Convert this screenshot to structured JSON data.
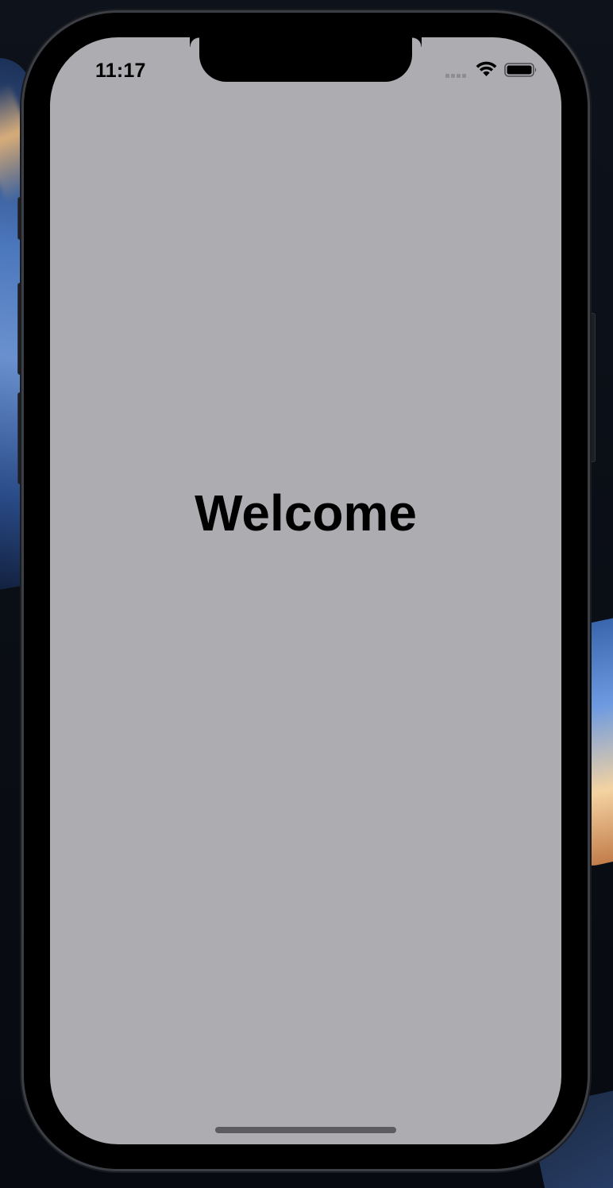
{
  "status_bar": {
    "time": "11:17",
    "icons": [
      "cellular-signal-icon",
      "wifi-icon",
      "battery-icon"
    ]
  },
  "main": {
    "heading": "Welcome"
  },
  "colors": {
    "screen_background": "#adacb1",
    "text": "#000000",
    "device_frame": "#000000",
    "home_indicator": "#5b5b60"
  }
}
